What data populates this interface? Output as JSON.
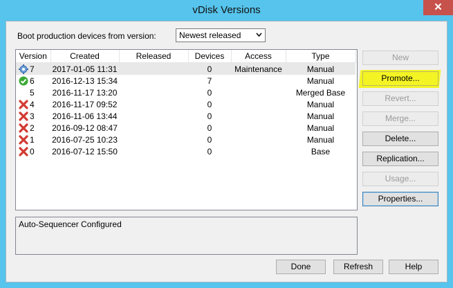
{
  "window": {
    "title": "vDisk Versions",
    "close_glyph": "✕"
  },
  "boot": {
    "label": "Boot production devices from version:",
    "selected": "Newest released"
  },
  "table": {
    "headers": [
      "Version",
      "Created",
      "Released",
      "Devices",
      "Access",
      "Type"
    ],
    "rows": [
      {
        "icon": "gear-blue-icon",
        "version": "7",
        "created": "2017-01-05 11:31",
        "released": "",
        "devices": "0",
        "access": "Maintenance",
        "type": "Manual"
      },
      {
        "icon": "check-green-icon",
        "version": "6",
        "created": "2016-12-13 15:34",
        "released": "",
        "devices": "7",
        "access": "",
        "type": "Manual"
      },
      {
        "icon": "",
        "version": "5",
        "created": "2016-11-17 13:20",
        "released": "",
        "devices": "0",
        "access": "",
        "type": "Merged Base"
      },
      {
        "icon": "x-red-icon",
        "version": "4",
        "created": "2016-11-17 09:52",
        "released": "",
        "devices": "0",
        "access": "",
        "type": "Manual"
      },
      {
        "icon": "x-red-icon",
        "version": "3",
        "created": "2016-11-06 13:44",
        "released": "",
        "devices": "0",
        "access": "",
        "type": "Manual"
      },
      {
        "icon": "x-red-icon",
        "version": "2",
        "created": "2016-09-12 08:47",
        "released": "",
        "devices": "0",
        "access": "",
        "type": "Manual"
      },
      {
        "icon": "x-red-icon",
        "version": "1",
        "created": "2016-07-25 10:23",
        "released": "",
        "devices": "0",
        "access": "",
        "type": "Manual"
      },
      {
        "icon": "x-red-icon",
        "version": "0",
        "created": "2016-07-12 15:50",
        "released": "",
        "devices": "0",
        "access": "",
        "type": "Base"
      }
    ]
  },
  "description": "Auto-Sequencer Configured",
  "side_buttons": {
    "new": "New",
    "promote": "Promote...",
    "revert": "Revert...",
    "merge": "Merge...",
    "delete": "Delete...",
    "replication": "Replication...",
    "usage": "Usage...",
    "properties": "Properties..."
  },
  "bottom_buttons": {
    "done": "Done",
    "refresh": "Refresh",
    "help": "Help"
  },
  "colors": {
    "title_bar": "#56c4ec",
    "close": "#c7514b",
    "highlight": "#f5f500",
    "selected_row": "#e8e8e8"
  }
}
